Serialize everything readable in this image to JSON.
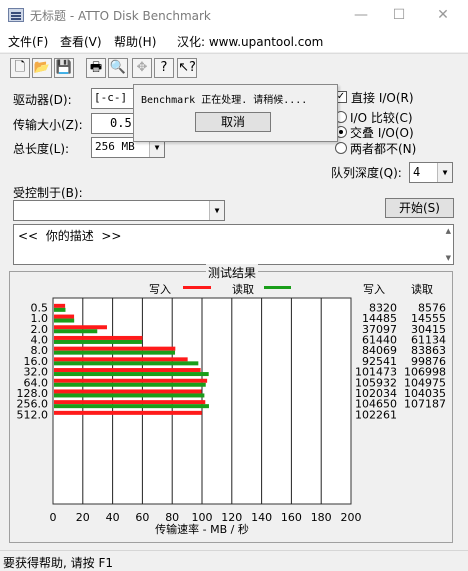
{
  "window": {
    "title": "无标题 - ATTO Disk Benchmark",
    "minimize": "—",
    "maximize": "☐",
    "close": "✕"
  },
  "menu": {
    "file": "文件(F)",
    "view": "查看(V)",
    "help": "帮助(H)",
    "localize": "汉化: www.upantool.com"
  },
  "toolbar": {
    "icons": [
      "new-file-icon",
      "open-folder-icon",
      "save-icon",
      "print-icon",
      "print-preview-icon",
      "move-icon",
      "help-icon",
      "context-help-icon"
    ]
  },
  "form": {
    "drive_label": "驱动器(D):",
    "drive_value": "[-c-]",
    "transfer_label": "传输大小(Z):",
    "transfer_value": "0.5",
    "length_label": "总长度(L):",
    "length_value": "256 MB",
    "direct_io_label": "直接 I/O(R)",
    "io_compare_label": "I/O 比较(C)",
    "overlap_label": "交叠 I/O(O)",
    "neither_label": "两者都不(N)",
    "queue_label": "队列深度(Q):",
    "queue_value": "4",
    "controlled_label": "受控制于(B):",
    "controlled_value": "",
    "start_button": "开始(S)",
    "description": "<<  你的描述  >>"
  },
  "popup": {
    "message": "Benchmark 正在处理. 请稍候....",
    "cancel": "取消"
  },
  "results": {
    "title": "测试结果",
    "legend_write": "写入",
    "legend_read": "读取",
    "col_write": "写入",
    "col_read": "读取"
  },
  "colors": {
    "write": "#ff1a1a",
    "read": "#1a9e1a"
  },
  "chart_data": {
    "type": "bar",
    "orientation": "horizontal",
    "categories": [
      "0.5",
      "1.0",
      "2.0",
      "4.0",
      "8.0",
      "16.0",
      "32.0",
      "64.0",
      "128.0",
      "256.0",
      "512.0"
    ],
    "series": [
      {
        "name": "写入",
        "values": [
          8320,
          14485,
          37097,
          61440,
          84069,
          92541,
          101473,
          105932,
          102034,
          104650,
          102261
        ]
      },
      {
        "name": "读取",
        "values": [
          8576,
          14555,
          30415,
          61134,
          83863,
          99876,
          106998,
          104975,
          104035,
          107187,
          null
        ]
      }
    ],
    "xlabel": "传输速率 - MB / 秒",
    "xlim": [
      0,
      200
    ],
    "xticks": [
      "0",
      "20",
      "40",
      "60",
      "80",
      "100",
      "120",
      "140",
      "160",
      "180",
      "200"
    ],
    "grid": true,
    "legend": "top"
  },
  "status_text": "要获得帮助, 请按 F1"
}
